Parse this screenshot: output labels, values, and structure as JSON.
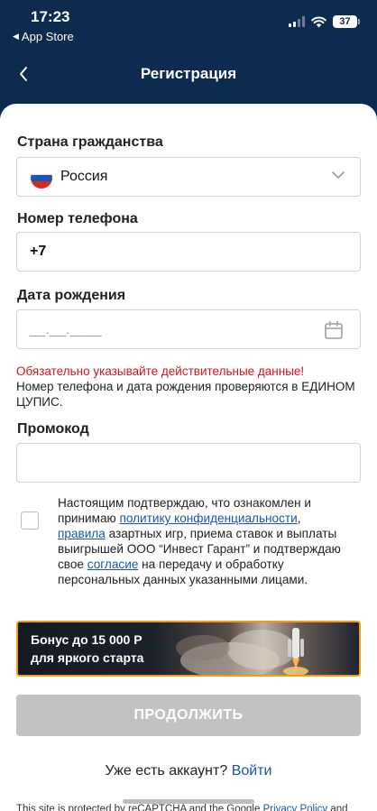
{
  "status": {
    "time": "17:23",
    "back_app": "App Store",
    "battery": "37"
  },
  "nav": {
    "title": "Регистрация"
  },
  "form": {
    "country_label": "Страна гражданства",
    "country_value": "Россия",
    "phone_label": "Номер телефона",
    "phone_value": "+7",
    "dob_label": "Дата рождения",
    "dob_placeholder": "__.__.____",
    "warning_red": "Обязательно указывайте действительные данные!",
    "warning_black": "Номер телефона и дата рождения проверяются в ЕДИНОМ ЦУПИС.",
    "promo_label": "Промокод",
    "promo_value": ""
  },
  "consent": {
    "part1": "Настоящим подтверждаю, что ознакомлен и принимаю ",
    "link1": "политику конфиденциальности",
    "sep": ", ",
    "link2": "правила",
    "part2": " азартных игр, приема ставок и выплаты выигрышей ООО “Инвест Гарант” и подтверждаю свое ",
    "link3": "согласие",
    "part3": " на передачу и обработку персональных данных указанными лицами.",
    "checked": false
  },
  "banner": {
    "line1": "Бонус до 15 000 Р",
    "line2": "для яркого старта"
  },
  "buttons": {
    "continue": "ПРОДОЛЖИТЬ"
  },
  "footer": {
    "have_account": "Уже есть аккаунт?",
    "login": "Войти",
    "recaptcha_text": "This site is protected by reCAPTCHA and the Google ",
    "privacy_link": "Privacy Policy",
    "recaptcha_and": " and"
  },
  "colors": {
    "header_bg": "#0d2a4f",
    "warning": "#d0161b",
    "link": "#1a56a8",
    "banner_border": "#f29a1c",
    "button_disabled": "#c2c2c2"
  },
  "icons": {
    "back": "chevron-left-icon",
    "dropdown": "chevron-down-icon",
    "calendar": "calendar-icon",
    "flag": "russia-flag-icon"
  }
}
